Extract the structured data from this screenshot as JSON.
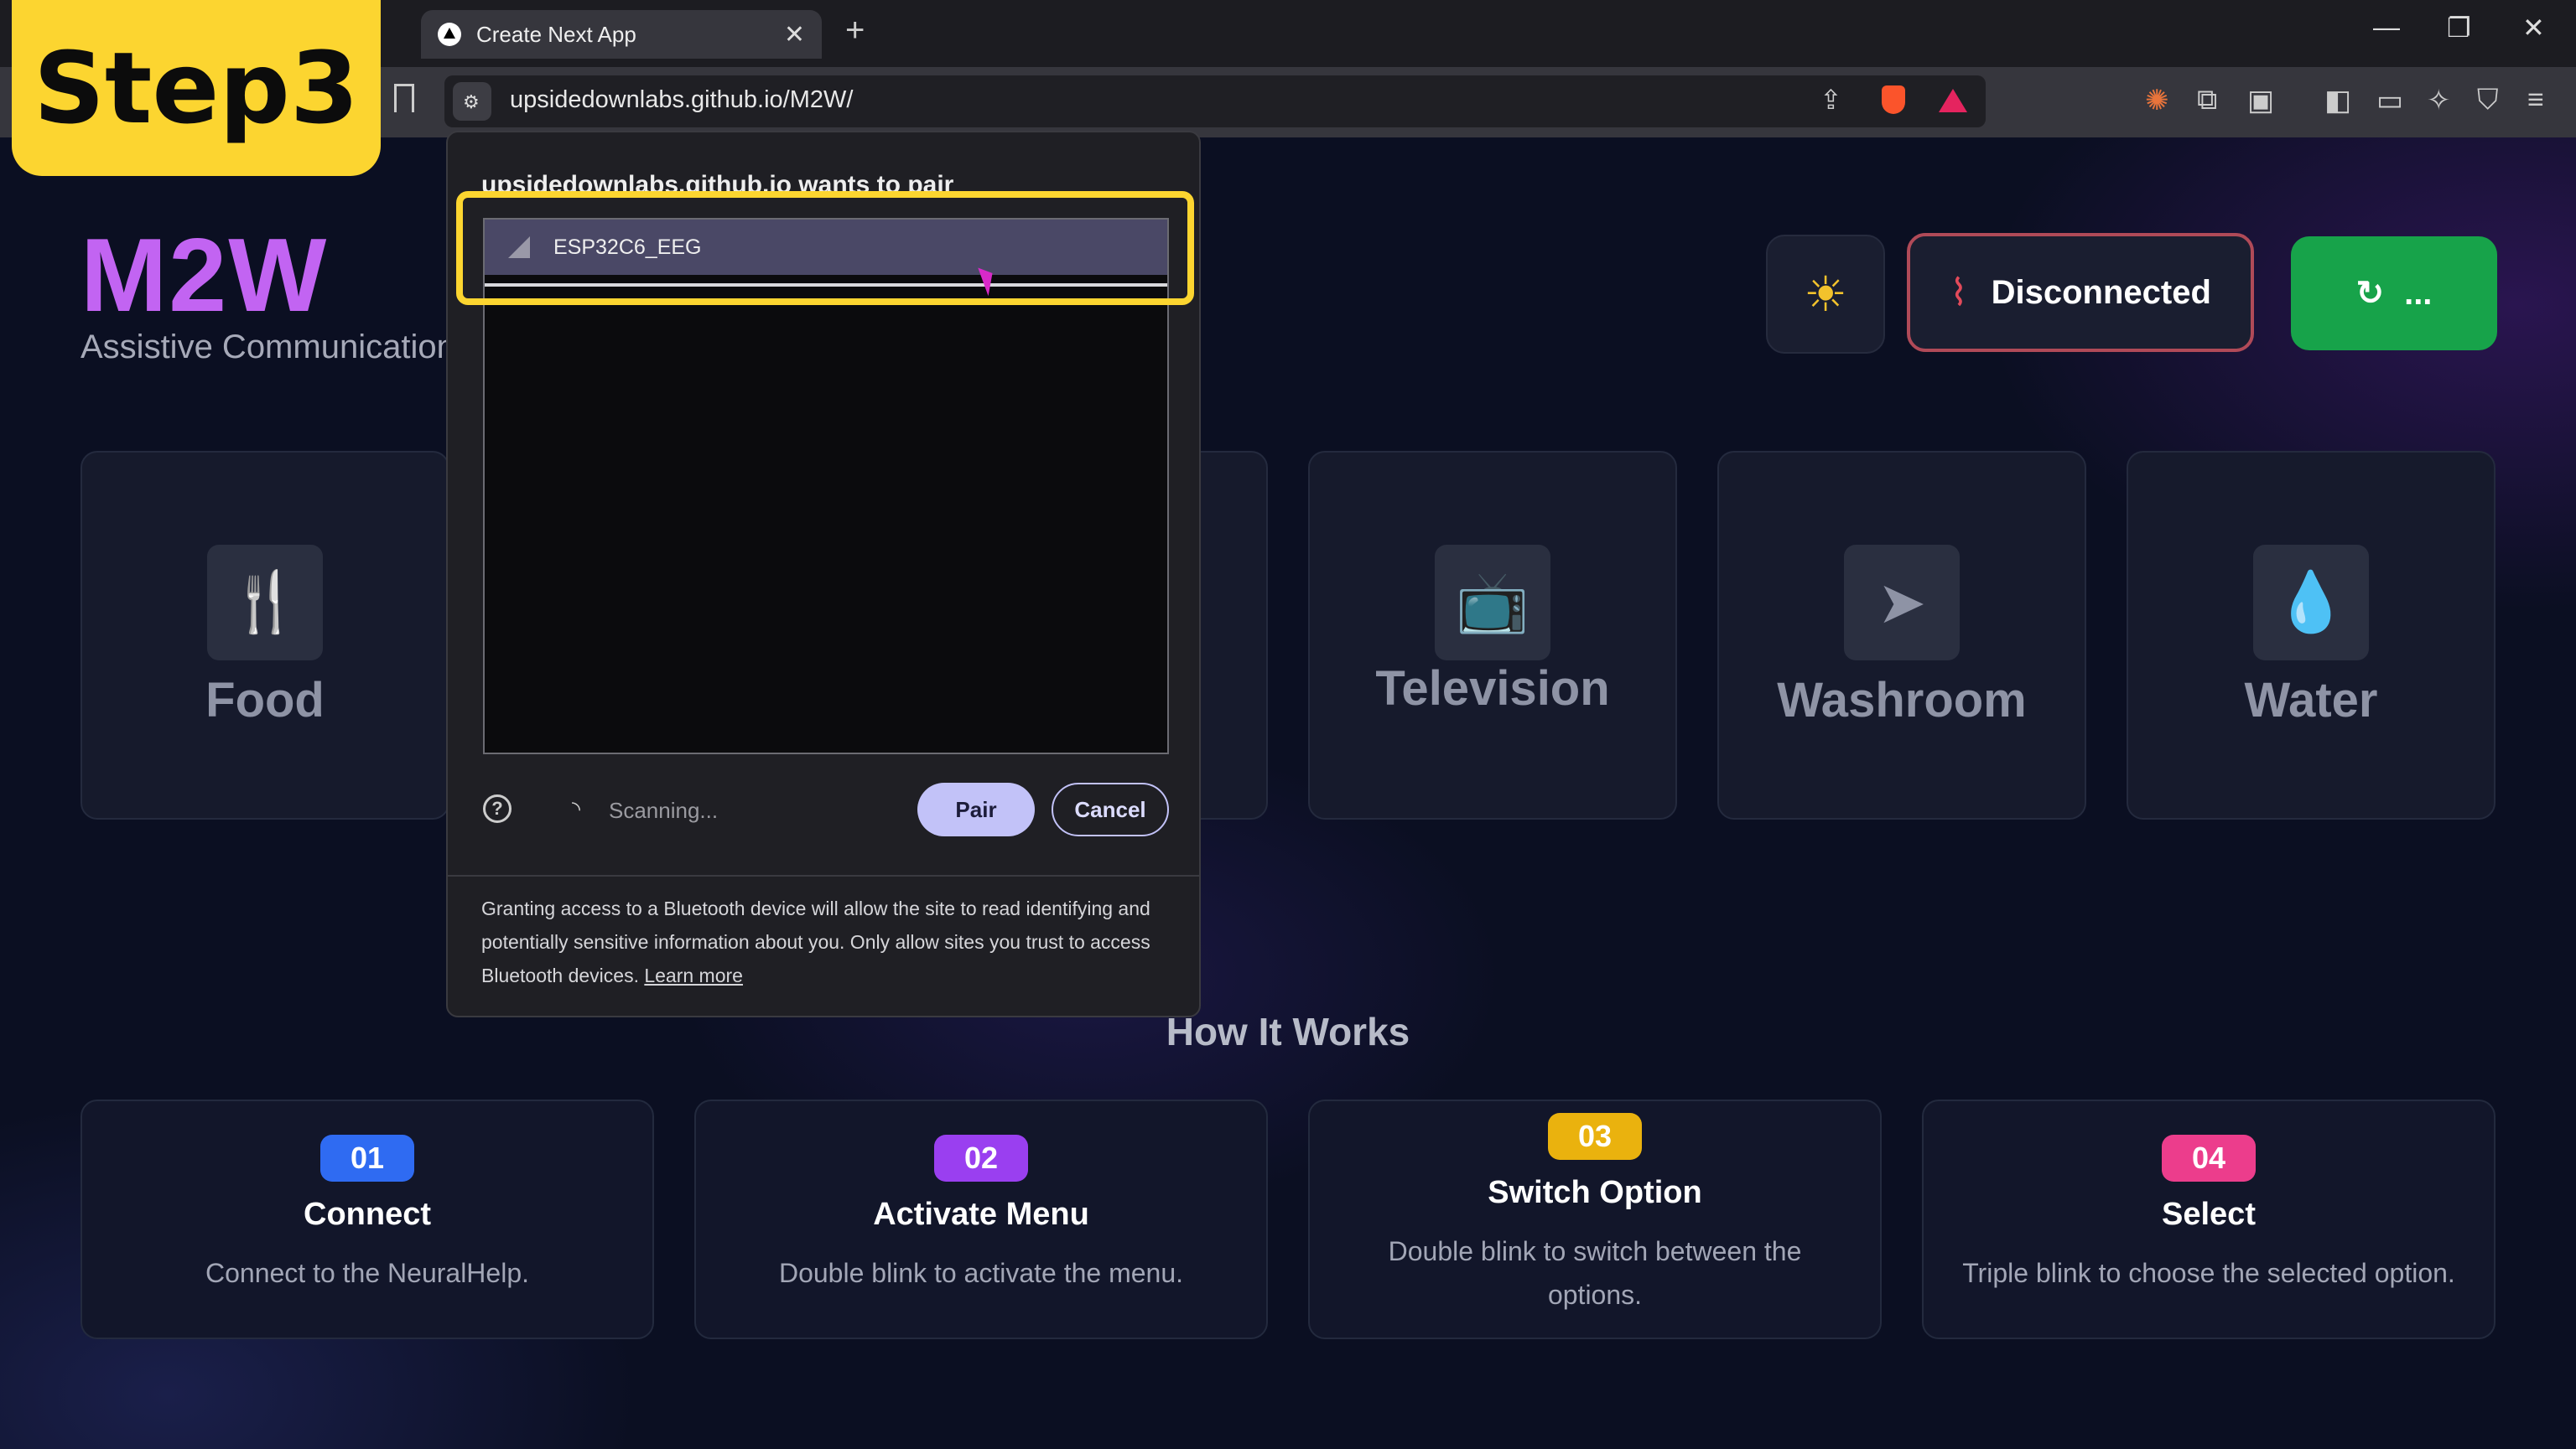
{
  "overlay": {
    "step_label": "Step3"
  },
  "browser": {
    "tab_title": "Create Next App",
    "tab_close": "✕",
    "new_tab": "+",
    "url": "upsidedownlabs.github.io/M2W/",
    "window_controls": {
      "minimize": "—",
      "restore": "❐",
      "close": "✕"
    }
  },
  "header": {
    "brand": "M2W",
    "tagline": "Assistive Communication",
    "theme_icon": "sun-icon",
    "status_label": "Disconnected",
    "status_icon": "wifi-off-icon",
    "connect_label": "...",
    "colors": {
      "brand": "#c264f2",
      "status_border": "#b04a58",
      "connect_bg": "#17a34a"
    }
  },
  "cards": [
    {
      "label": "Food",
      "icon": "utensils-icon"
    },
    {
      "label": "Television",
      "icon": "tv-icon"
    },
    {
      "label": "Washroom",
      "icon": "navigation-icon"
    },
    {
      "label": "Water",
      "icon": "droplets-icon"
    }
  ],
  "how_it_works": {
    "heading": "How It Works",
    "steps": [
      {
        "num": "01",
        "title": "Connect",
        "desc": "Connect to the NeuralHelp.",
        "color": "#2f6bf2"
      },
      {
        "num": "02",
        "title": "Activate Menu",
        "desc": "Double blink to activate the menu.",
        "color": "#9a3ff0"
      },
      {
        "num": "03",
        "title": "Switch Option",
        "desc": "Double blink to switch between the options.",
        "color": "#eab20e"
      },
      {
        "num": "04",
        "title": "Select",
        "desc": "Triple blink to choose the selected option.",
        "color": "#ec3d8c"
      }
    ]
  },
  "bluetooth_dialog": {
    "title": "upsidedownlabs.github.io wants to pair",
    "device": "ESP32C6_EEG",
    "status": "Scanning...",
    "pair_label": "Pair",
    "cancel_label": "Cancel",
    "note": "Granting access to a Bluetooth device will allow the site to read identifying and potentially sensitive information about you. Only allow sites you trust to access Bluetooth devices.",
    "learn_more": "Learn more"
  }
}
